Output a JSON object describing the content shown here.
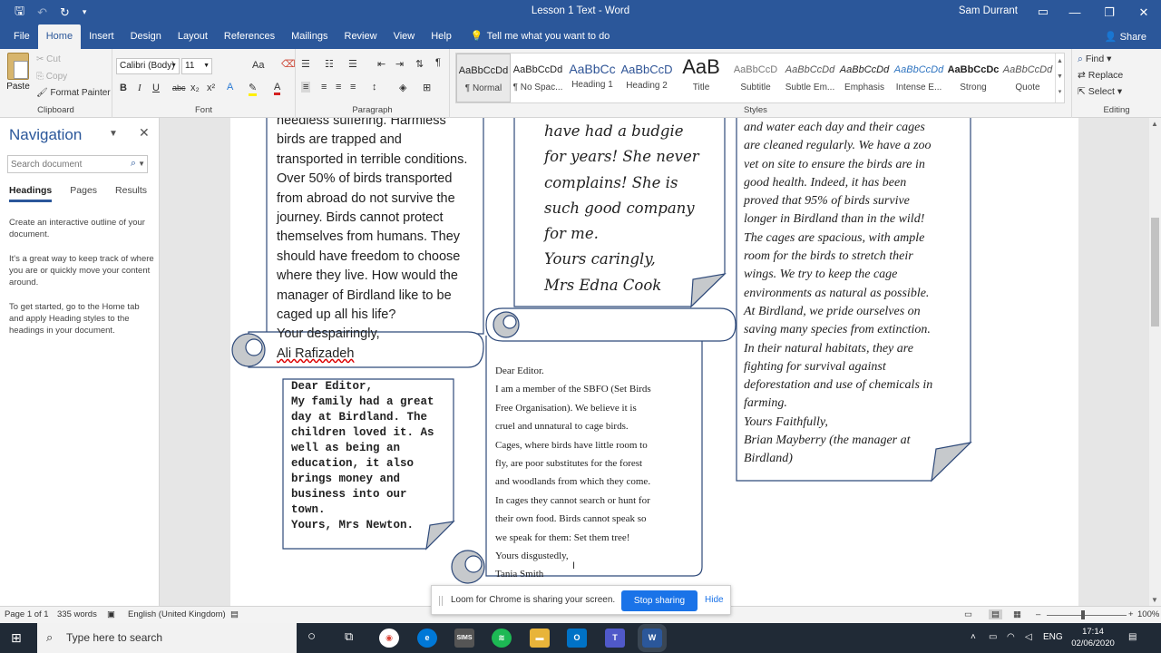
{
  "window": {
    "doc_title": "Lesson 1 Text  -  Word",
    "user": "Sam Durrant",
    "minimize": "—",
    "maximize": "❐",
    "close": "✕"
  },
  "quick_access": {
    "save": "🖫",
    "undo": "↶",
    "redo": "↻",
    "customize": "▾"
  },
  "tabs": [
    "File",
    "Home",
    "Insert",
    "Design",
    "Layout",
    "References",
    "Mailings",
    "Review",
    "View",
    "Help"
  ],
  "tell_me": "Tell me what you want to do",
  "share": "Share",
  "clipboard": {
    "paste": "Paste",
    "cut": "Cut",
    "copy": "Copy",
    "format_painter": "Format Painter",
    "label": "Clipboard"
  },
  "font": {
    "name": "Calibri (Body)",
    "size": "11",
    "grow": "A˄",
    "shrink": "Aa",
    "bold": "B",
    "italic": "I",
    "underline": "U",
    "strike": "abc",
    "subscript": "x₂",
    "superscript": "x²",
    "color_a": "A",
    "label": "Font"
  },
  "paragraph": {
    "label": "Paragraph",
    "pilcrow": "¶"
  },
  "styles": {
    "label": "Styles",
    "items": [
      {
        "preview": "AaBbCcDd",
        "name": "¶ Normal"
      },
      {
        "preview": "AaBbCcDd",
        "name": "¶ No Spac..."
      },
      {
        "preview": "AaBbCc",
        "name": "Heading 1"
      },
      {
        "preview": "AaBbCcD",
        "name": "Heading 2"
      },
      {
        "preview": "AaB",
        "name": "Title"
      },
      {
        "preview": "AaBbCcD",
        "name": "Subtitle"
      },
      {
        "preview": "AaBbCcDd",
        "name": "Subtle Em..."
      },
      {
        "preview": "AaBbCcDd",
        "name": "Emphasis"
      },
      {
        "preview": "AaBbCcDd",
        "name": "Intense E..."
      },
      {
        "preview": "AaBbCcDc",
        "name": "Strong"
      },
      {
        "preview": "AaBbCcDd",
        "name": "Quote"
      }
    ]
  },
  "editing": {
    "find": "Find",
    "replace": "Replace",
    "select": "Select",
    "label": "Editing"
  },
  "navigation": {
    "title": "Navigation",
    "search_placeholder": "Search document",
    "tabs": [
      "Headings",
      "Pages",
      "Results"
    ],
    "para1": "Create an interactive outline of your document.",
    "para2": "It's a great way to keep track of where you are or quickly move your content around.",
    "para3": "To get started, go to the Home tab and apply Heading styles to the headings in your document."
  },
  "letters": {
    "ali": [
      "needless suffering. Harmless",
      "birds are trapped and",
      "transported in terrible conditions.",
      "Over 50% of birds transported",
      "from abroad do not survive the",
      "journey. Birds cannot protect",
      "themselves from humans. They",
      "should have freedom to choose",
      "where they live. How would the",
      "manager of Birdland like to be",
      "caged up all his life?",
      "Your despairingly,",
      "Ali Rafizadeh"
    ],
    "edna": [
      "have had a budgie",
      "for years! She never",
      "complains! She is",
      "such good company",
      "for me.",
      "Yours caringly,",
      "Mrs Edna Cook"
    ],
    "brian": [
      "and water each day and their cages",
      "are cleaned regularly. We have a zoo",
      "vet on site to ensure the birds are in",
      "good health. Indeed, it has been",
      "proved that 95% of birds survive",
      "longer in Birdland than in the wild!",
      "The cages are spacious, with ample",
      "room for the birds to stretch their",
      "wings. We try to keep the cage",
      "environments as natural as possible.",
      "At Birdland, we pride ourselves on",
      "saving many species from extinction.",
      "In their natural habitats, they are",
      "fighting for survival against",
      "deforestation and use of chemicals in",
      "farming.",
      "Yours Faithfully,",
      "Brian Mayberry (the manager at",
      "Birdland)"
    ],
    "newton": [
      "Dear Editor,",
      "My family had a great",
      "day at Birdland. The",
      "children loved it. As",
      "well as being an",
      "education, it also",
      "brings money and",
      "business into our",
      "town.",
      "Yours, Mrs Newton."
    ],
    "tania": [
      "Dear Editor.",
      "I am a member of the SBFO (Set Birds",
      "Free Organisation). We believe it is",
      "cruel and unnatural to cage birds.",
      "Cages, where birds have little room to",
      "fly, are poor substitutes for the forest",
      "and woodlands from which they come.",
      "In cages they cannot search or hunt for",
      "their own food. Birds cannot speak so",
      "we speak for them: Set them tree!",
      "Yours disgustedly,",
      "Tania Smith"
    ]
  },
  "status": {
    "page": "Page 1 of 1",
    "words": "335 words",
    "language": "English (United Kingdom)",
    "zoom": "100%",
    "zoom_minus": "–",
    "zoom_plus": "+"
  },
  "loom": {
    "message": "Loom for Chrome is sharing your screen.",
    "stop": "Stop sharing",
    "hide": "Hide"
  },
  "taskbar": {
    "search_placeholder": "Type here to search",
    "sims": "SIMS",
    "lang": "ENG",
    "time": "17:14",
    "date": "02/06/2020"
  },
  "colors": {
    "word_blue": "#2b579a",
    "loom_blue": "#1a73e8",
    "taskbar": "#202a36",
    "scroll_fold": "#c6c9cc"
  }
}
